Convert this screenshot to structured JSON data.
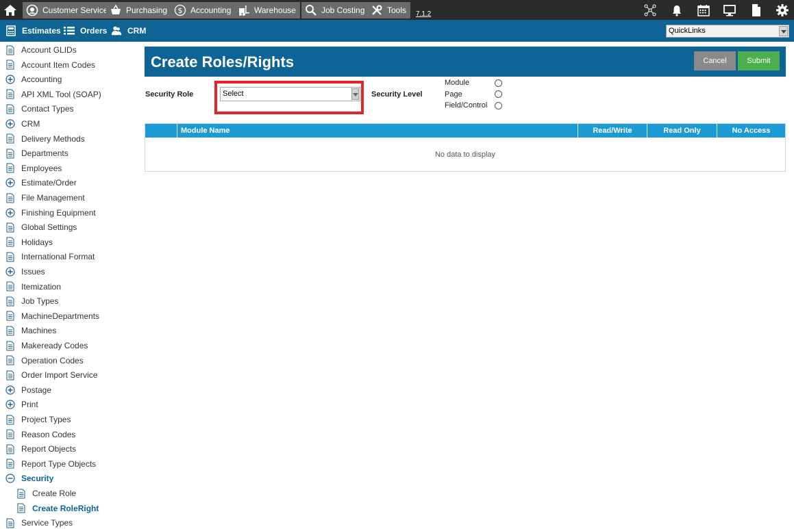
{
  "topbar": {
    "nav": [
      {
        "label": "Customer Service",
        "icon": "customer-service-icon"
      },
      {
        "label": "Purchasing",
        "icon": "basket-icon"
      },
      {
        "label": "Accounting",
        "icon": "dollar-icon"
      },
      {
        "label": "Warehouse",
        "icon": "forklift-icon"
      },
      {
        "label": "Job Costing",
        "icon": "magnifier-icon"
      },
      {
        "label": "Tools",
        "icon": "tools-icon"
      }
    ],
    "version": "7.1.2",
    "right_icons": [
      "network-icon",
      "bell-icon",
      "calendar-icon",
      "monitor-icon",
      "document-icon",
      "gear-icon"
    ]
  },
  "secondbar": {
    "items": [
      {
        "label": "Estimates",
        "icon": "calculator-icon"
      },
      {
        "label": "Orders",
        "icon": "list-icon"
      },
      {
        "label": "CRM",
        "icon": "users-icon"
      }
    ],
    "quicklinks": "QuickLinks"
  },
  "sidebar": {
    "items": [
      {
        "label": "Account GLIDs",
        "type": "page"
      },
      {
        "label": "Account Item Codes",
        "type": "page"
      },
      {
        "label": "Accounting",
        "type": "expand"
      },
      {
        "label": "API XML Tool (SOAP)",
        "type": "page"
      },
      {
        "label": "Contact Types",
        "type": "page"
      },
      {
        "label": "CRM",
        "type": "expand"
      },
      {
        "label": "Delivery Methods",
        "type": "page"
      },
      {
        "label": "Departments",
        "type": "page"
      },
      {
        "label": "Employees",
        "type": "page"
      },
      {
        "label": "Estimate/Order",
        "type": "expand"
      },
      {
        "label": "File Management",
        "type": "page"
      },
      {
        "label": "Finishing Equipment",
        "type": "expand"
      },
      {
        "label": "Global Settings",
        "type": "page"
      },
      {
        "label": "Holidays",
        "type": "page"
      },
      {
        "label": "International Format",
        "type": "page"
      },
      {
        "label": "Issues",
        "type": "expand"
      },
      {
        "label": "Itemization",
        "type": "page"
      },
      {
        "label": "Job Types",
        "type": "page"
      },
      {
        "label": "MachineDepartments",
        "type": "page"
      },
      {
        "label": "Machines",
        "type": "page"
      },
      {
        "label": "Makeready Codes",
        "type": "page"
      },
      {
        "label": "Operation Codes",
        "type": "page"
      },
      {
        "label": "Order Import Service",
        "type": "page"
      },
      {
        "label": "Postage",
        "type": "expand"
      },
      {
        "label": "Print",
        "type": "expand"
      },
      {
        "label": "Project Types",
        "type": "page"
      },
      {
        "label": "Reason Codes",
        "type": "page"
      },
      {
        "label": "Report Objects",
        "type": "page"
      },
      {
        "label": "Report Type Objects",
        "type": "page"
      },
      {
        "label": "Security",
        "type": "collapse"
      },
      {
        "label": "Create Role",
        "type": "child"
      },
      {
        "label": "Create RoleRight",
        "type": "child-active"
      },
      {
        "label": "Service Types",
        "type": "page"
      }
    ]
  },
  "main": {
    "title": "Create Roles/Rights",
    "cancel": "Cancel",
    "submit": "Submit",
    "security_role_label": "Security Role",
    "security_role_value": "Select",
    "security_level_label": "Security Level",
    "levels": [
      "Module",
      "Page",
      "Field/Control"
    ],
    "grid": {
      "columns": [
        "",
        "Module Name",
        "Read/Write",
        "Read Only",
        "No Access"
      ],
      "empty_text": "No data to display"
    }
  },
  "colors": {
    "topbar": "#2b2b2b",
    "nav_button": "#6b6b6b",
    "primary": "#0f6496",
    "grid_header": "#1c9ad6",
    "submit": "#4cae4c",
    "cancel": "#8a8a8a",
    "highlight": "#e3242b"
  }
}
